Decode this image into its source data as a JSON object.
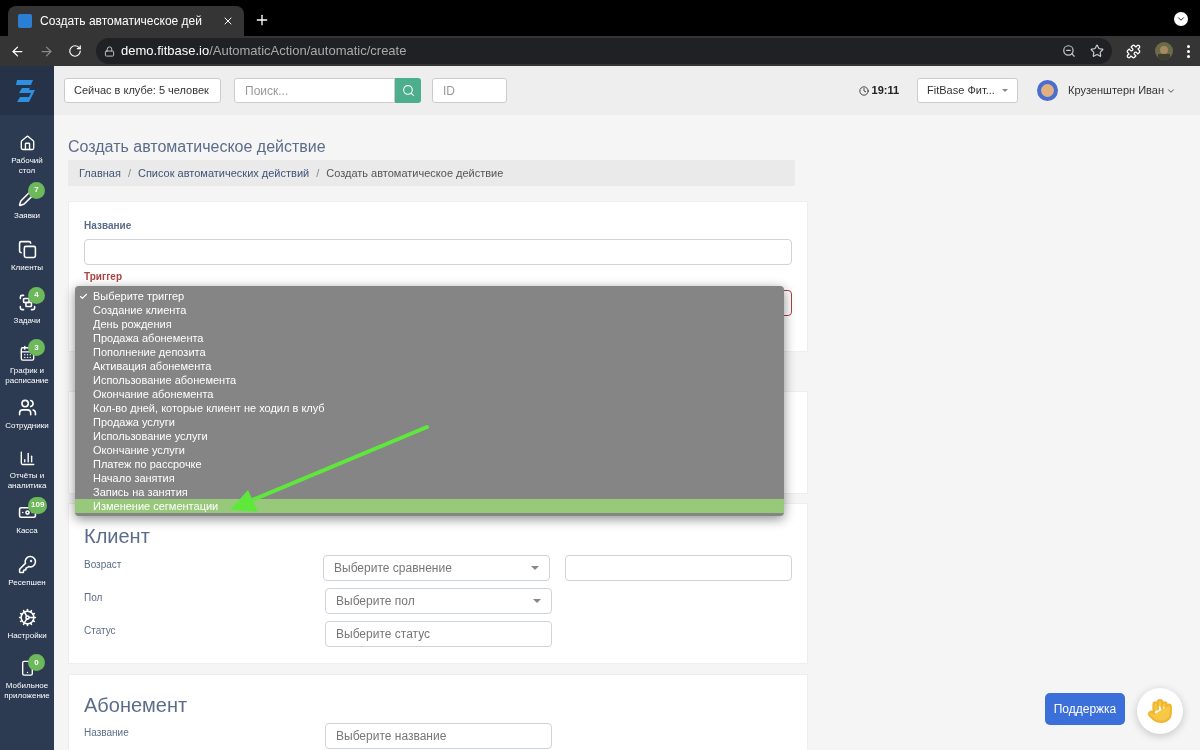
{
  "browser": {
    "tab_title": "Создать автоматическое дей",
    "url_domain": "demo.fitbase.io",
    "url_path": "/AutomaticAction/automatic/create"
  },
  "header": {
    "club_count": "Сейчас в клубе: 5 человек",
    "search_placeholder": "Поиск...",
    "id_placeholder": "ID",
    "time": "19:11",
    "club_select": "FitBase Фит...",
    "user_name": "Крузенштерн Иван"
  },
  "sidebar": {
    "items": [
      {
        "label": "Рабочий стол"
      },
      {
        "label": "Заявки",
        "badge": "7"
      },
      {
        "label": "Клиенты"
      },
      {
        "label": "Задачи",
        "badge": "4"
      },
      {
        "label": "График и расписание",
        "badge": "3"
      },
      {
        "label": "Сотрудники"
      },
      {
        "label": "Отчёты и аналитика"
      },
      {
        "label": "Касса",
        "badge": "109"
      },
      {
        "label": "Ресепшен"
      },
      {
        "label": "Настройки"
      },
      {
        "label": "Мобильное приложение",
        "badge": "0"
      }
    ]
  },
  "page": {
    "title": "Создать автоматическое действие",
    "breadcrumbs": [
      {
        "label": "Главная",
        "kind": "link",
        "separator": "/"
      },
      {
        "label": "Список автоматических действий",
        "kind": "link",
        "separator": "/"
      },
      {
        "label": "Создать автоматическое действие",
        "kind": "current"
      }
    ]
  },
  "form": {
    "name_label": "Название",
    "trigger_label": "Триггер",
    "trigger_options": [
      {
        "label": "Выберите триггер",
        "selected": true,
        "highlighted": false
      },
      {
        "label": "Создание клиента",
        "selected": false,
        "highlighted": false
      },
      {
        "label": "День рождения",
        "selected": false,
        "highlighted": false
      },
      {
        "label": "Продажа абонемента",
        "selected": false,
        "highlighted": false
      },
      {
        "label": "Пополнение депозита",
        "selected": false,
        "highlighted": false
      },
      {
        "label": "Активация абонемента",
        "selected": false,
        "highlighted": false
      },
      {
        "label": "Использование абонемента",
        "selected": false,
        "highlighted": false
      },
      {
        "label": "Окончание абонемента",
        "selected": false,
        "highlighted": false
      },
      {
        "label": "Кол-во дней, которые клиент не ходил в клуб",
        "selected": false,
        "highlighted": false
      },
      {
        "label": "Продажа услуги",
        "selected": false,
        "highlighted": false
      },
      {
        "label": "Использование услуги",
        "selected": false,
        "highlighted": false
      },
      {
        "label": "Окончание услуги",
        "selected": false,
        "highlighted": false
      },
      {
        "label": "Платеж по рассрочке",
        "selected": false,
        "highlighted": false
      },
      {
        "label": "Начало занятия",
        "selected": false,
        "highlighted": false
      },
      {
        "label": "Запись на занятия",
        "selected": false,
        "highlighted": false
      },
      {
        "label": "Изменение сегментации",
        "selected": false,
        "highlighted": true
      }
    ]
  },
  "sections": [
    {
      "heading": "Клиент",
      "rows": [
        {
          "label": "Возраст",
          "fields": [
            {
              "kind": "select",
              "placeholder": "Выберите сравнение"
            },
            {
              "kind": "text"
            }
          ]
        },
        {
          "label": "Пол",
          "fields": [
            {
              "kind": "select",
              "placeholder": "Выберите пол"
            }
          ]
        },
        {
          "label": "Статус",
          "fields": [
            {
              "kind": "text",
              "placeholder": "Выберите статус"
            }
          ]
        }
      ]
    },
    {
      "heading": "Абонемент",
      "rows": [
        {
          "label": "Название",
          "fields": [
            {
              "kind": "text",
              "placeholder": "Выберите название"
            }
          ]
        }
      ]
    }
  ],
  "support": {
    "label": "Поддержка"
  }
}
